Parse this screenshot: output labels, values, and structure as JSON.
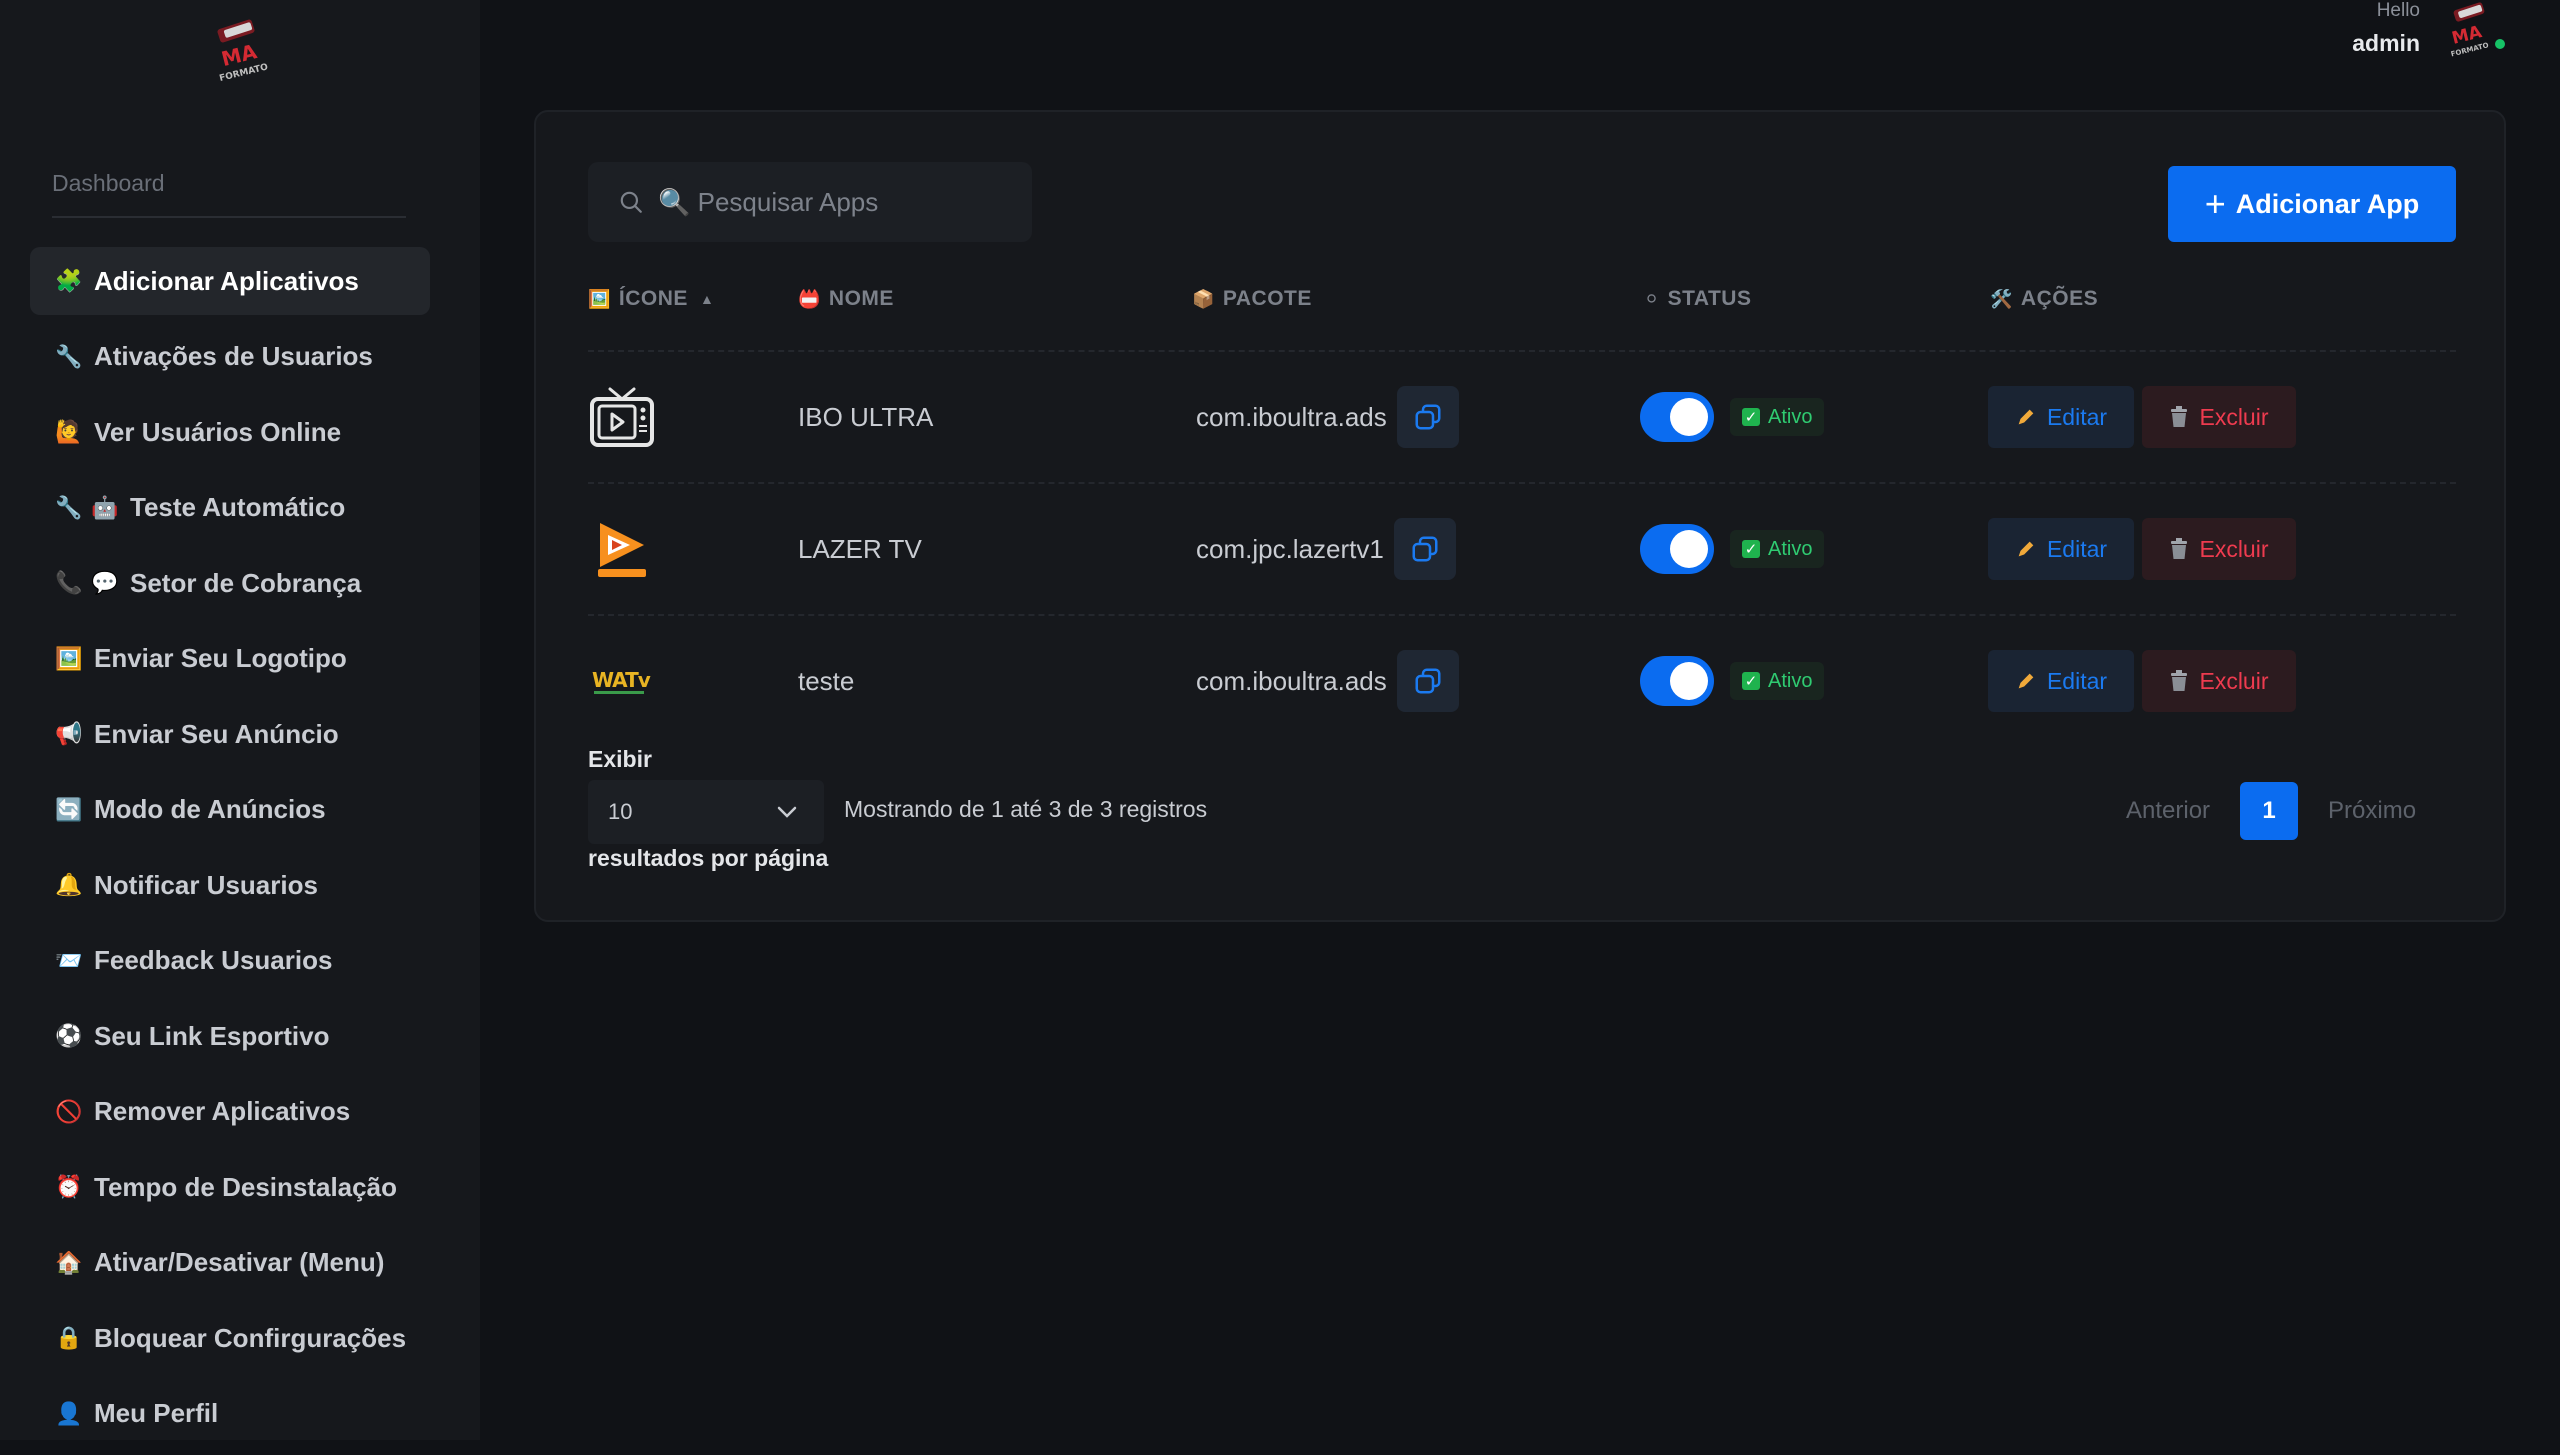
{
  "sidebar": {
    "section_label": "Dashboard",
    "items": [
      {
        "icon": "puzzle-icon",
        "glyph": "🧩",
        "label": "Adicionar Aplicativos",
        "active": true
      },
      {
        "icon": "wrench-icon",
        "glyph": "🔧",
        "label": "Ativações de Usuarios"
      },
      {
        "icon": "person-raising-hand-icon",
        "glyph": "🙋",
        "label": "Ver Usuários Online"
      },
      {
        "icon": "wrench-robot-icon",
        "glyph": "🔧",
        "glyph2": "🤖",
        "label": "Teste Automático"
      },
      {
        "icon": "phone-speech-icon",
        "glyph": "📞",
        "glyph2": "💬",
        "label": "Setor de Cobrança"
      },
      {
        "icon": "picture-icon",
        "glyph": "🖼️",
        "label": "Enviar Seu Logotipo"
      },
      {
        "icon": "megaphone-icon",
        "glyph": "📢",
        "label": "Enviar Seu Anúncio"
      },
      {
        "icon": "cycle-icon",
        "glyph": "🔄",
        "label": "Modo de Anúncios"
      },
      {
        "icon": "bell-icon",
        "glyph": "🔔",
        "label": "Notificar Usuarios"
      },
      {
        "icon": "mailbox-icon",
        "glyph": "📨",
        "label": "Feedback Usuarios"
      },
      {
        "icon": "soccer-ball-icon",
        "glyph": "⚽",
        "label": "Seu Link Esportivo"
      },
      {
        "icon": "prohibited-icon",
        "glyph": "🚫",
        "label": "Remover Aplicativos"
      },
      {
        "icon": "alarm-clock-icon",
        "glyph": "⏰",
        "label": "Tempo de Desinstalação"
      },
      {
        "icon": "house-icon",
        "glyph": "🏠",
        "label": "Ativar/Desativar (Menu)"
      },
      {
        "icon": "lock-icon",
        "glyph": "🔒",
        "label": "Bloquear Confirgurações"
      },
      {
        "icon": "person-icon",
        "glyph": "👤",
        "label": "Meu Perfil"
      }
    ]
  },
  "header": {
    "greeting": "Hello",
    "username": "admin"
  },
  "search": {
    "placeholder": "🔍 Pesquisar Apps",
    "value": ""
  },
  "actions": {
    "add_app_label": "Adicionar App"
  },
  "table": {
    "columns": [
      {
        "key": "icone",
        "glyph": "🖼️",
        "label": "ÍCONE",
        "sortable": true
      },
      {
        "key": "nome",
        "glyph": "📛",
        "label": "NOME"
      },
      {
        "key": "pacote",
        "glyph": "📦",
        "label": "PACOTE"
      },
      {
        "key": "status",
        "glyph": "⚪",
        "label": "STATUS"
      },
      {
        "key": "acoes",
        "glyph": "🛠️",
        "label": "AÇÕES"
      }
    ],
    "rows": [
      {
        "icon": "tv-play-icon",
        "name": "IBO ULTRA",
        "package": "com.iboultra.ads",
        "enabled": true,
        "status": "Ativo",
        "edit_label": "Editar",
        "delete_label": "Excluir"
      },
      {
        "icon": "lazer-tv-logo-icon",
        "name": "LAZER TV",
        "package": "com.jpc.lazertv1",
        "enabled": true,
        "status": "Ativo",
        "edit_label": "Editar",
        "delete_label": "Excluir"
      },
      {
        "icon": "watv-logo-icon",
        "name": "teste",
        "package": "com.iboultra.ads",
        "enabled": true,
        "status": "Ativo",
        "edit_label": "Editar",
        "delete_label": "Excluir"
      }
    ]
  },
  "footer": {
    "show_label": "Exibir",
    "per_page_value": "10",
    "per_page_suffix": "resultados por página",
    "showing_text": "Mostrando de 1 até 3 de 3 registros",
    "prev_label": "Anterior",
    "current_page": "1",
    "next_label": "Próximo"
  },
  "colors": {
    "background": "#101216",
    "sidebar": "#16181c",
    "accent": "#0b6cf0",
    "success": "#2fcb71",
    "danger": "#ee3b4f"
  }
}
